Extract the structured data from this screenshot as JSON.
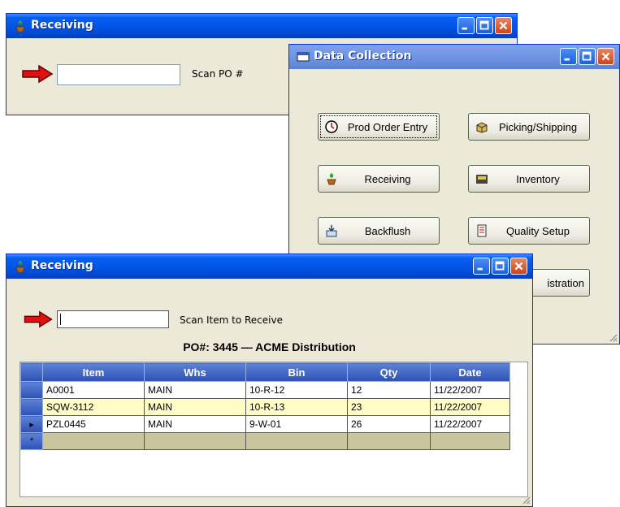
{
  "win1": {
    "title": "Receiving",
    "scan_label": "Scan PO #",
    "scan_value": ""
  },
  "win2": {
    "title": "Data Collection",
    "buttons": [
      {
        "label": "Prod Order Entry",
        "icon": "clock-icon"
      },
      {
        "label": "Picking/Shipping",
        "icon": "package-icon"
      },
      {
        "label": "Receiving",
        "icon": "receiving-plant-icon"
      },
      {
        "label": "Inventory",
        "icon": "inventory-icon"
      },
      {
        "label": "Backflush",
        "icon": "backflush-icon"
      },
      {
        "label": "Quality Setup",
        "icon": "document-icon"
      },
      {
        "label": "istration",
        "icon": ""
      }
    ]
  },
  "win3": {
    "title": "Receiving",
    "scan_label": "Scan Item to Receive",
    "scan_value": "",
    "po_header": "PO#: 3445 — ACME Distribution",
    "columns": [
      "Item",
      "Whs",
      "Bin",
      "Qty",
      "Date"
    ],
    "rows": [
      {
        "marker": "",
        "cells": [
          "A0001",
          "MAIN",
          "10-R-12",
          "12",
          "11/22/2007"
        ]
      },
      {
        "marker": "",
        "cells": [
          "SQW-3112",
          "MAIN",
          "10-R-13",
          "23",
          "11/22/2007"
        ]
      },
      {
        "marker": "▸",
        "cells": [
          "PZL0445",
          "MAIN",
          "9-W-01",
          "26",
          "11/22/2007"
        ]
      },
      {
        "marker": "*",
        "cells": [
          "",
          "",
          "",
          "",
          ""
        ]
      }
    ]
  },
  "colors": {
    "title_active": "#0054e3",
    "grid_header": "#2d52b5",
    "row_alt": "#fffcc8",
    "new_row": "#c9c69d",
    "arrow_red": "#e01010"
  }
}
